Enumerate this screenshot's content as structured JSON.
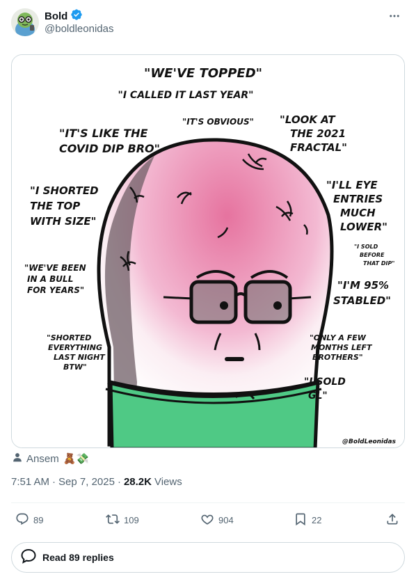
{
  "author": {
    "display_name": "Bold",
    "handle": "@boldleonidas",
    "verified": true
  },
  "icons": {
    "more": "more-horizontal-icon",
    "verified": "verified-badge-icon",
    "reply": "reply-icon",
    "repost": "repost-icon",
    "like": "like-icon",
    "bookmark": "bookmark-icon",
    "share": "share-icon",
    "person": "person-icon",
    "replies": "chat-bubble-icon"
  },
  "media": {
    "quotes": {
      "q1": "\"WE'VE TOPPED\"",
      "q2": "\"I CALLED IT LAST YEAR\"",
      "q3a": "\"IT'S LIKE THE",
      "q3b": "COVID DIP BRO\"",
      "q4": "\"IT'S OBVIOUS\"",
      "q5a": "\"LOOK AT",
      "q5b": "THE 2021",
      "q5c": "FRACTAL\"",
      "q6a": "\"I SHORTED",
      "q6b": "THE TOP",
      "q6c": "WITH SIZE\"",
      "q7a": "\"I'LL EYE",
      "q7b": "ENTRIES",
      "q7c": "MUCH",
      "q7d": "LOWER\"",
      "q8a": "\"I SOLD",
      "q8b": "BEFORE",
      "q8c": "THAT DIP\"",
      "q9a": "\"WE'VE BEEN",
      "q9b": "IN A BULL",
      "q9c": "FOR YEARS\"",
      "q10a": "\"I'M 95%",
      "q10b": "STABLED\"",
      "q11a": "\"SHORTED",
      "q11b": "EVERYTHING",
      "q11c": "LAST NIGHT",
      "q11d": "BTW\"",
      "q12a": "\"ONLY A FEW",
      "q12b": "MONTHS LEFT",
      "q12c": "BROTHERS\"",
      "q13a": "\"I SOLD",
      "q13b": "GL\""
    },
    "signature": "@BoldLeonidas",
    "colors": {
      "head_pink": "#e88ab8",
      "shirt_green": "#4fc985",
      "shadow": "#7a6a72"
    }
  },
  "attribution": {
    "name": "Ansem",
    "emoji": "🧸💸"
  },
  "meta": {
    "time": "7:51 AM",
    "separator1": "·",
    "date": "Sep 7, 2025",
    "separator2": "·",
    "views_count": "28.2K",
    "views_label": "Views"
  },
  "actions": {
    "replies": "89",
    "reposts": "109",
    "likes": "904",
    "bookmarks": "22"
  },
  "read_replies_label": "Read 89 replies"
}
